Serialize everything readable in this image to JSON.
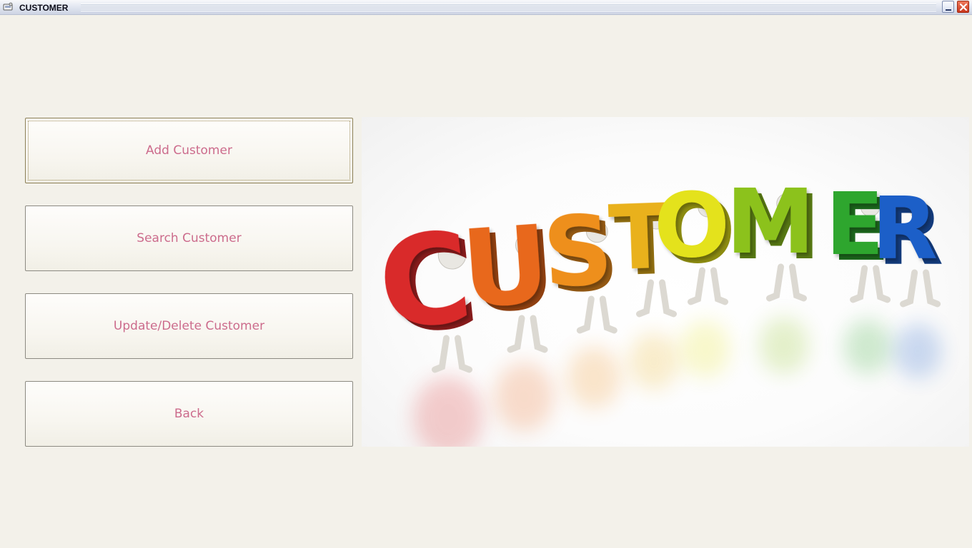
{
  "window": {
    "title": "CUSTOMER",
    "icon": "app-window-icon",
    "controls": [
      "minimize-icon",
      "close-icon"
    ]
  },
  "menu": {
    "buttons": [
      {
        "label": "Add Customer",
        "focused": true
      },
      {
        "label": "Search Customer"
      },
      {
        "label": "Update/Delete Customer"
      },
      {
        "label": "Back"
      }
    ],
    "label_color": "#cc6b8c"
  },
  "hero": {
    "word": "CUSTOMER",
    "letters": [
      {
        "char": "C",
        "color": "#d92b2b"
      },
      {
        "char": "U",
        "color": "#e8681a"
      },
      {
        "char": "S",
        "color": "#ee8f1e"
      },
      {
        "char": "T",
        "color": "#e9b11a"
      },
      {
        "char": "O",
        "color": "#e4e21a"
      },
      {
        "char": "M",
        "color": "#8cc21e"
      },
      {
        "char": "E",
        "color": "#2da62d"
      },
      {
        "char": "R",
        "color": "#1f5fc8"
      }
    ]
  }
}
